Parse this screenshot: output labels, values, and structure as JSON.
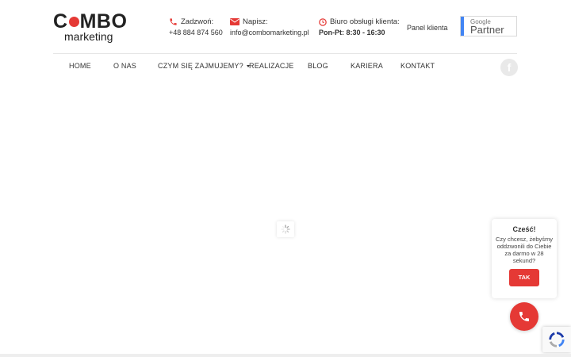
{
  "brand": {
    "logo_top_left": "C",
    "logo_top_right": "MBO",
    "logo_bottom": "marketing",
    "accent_color": "#e53935"
  },
  "contacts": {
    "phone": {
      "label": "Zadzwoń:",
      "value": "+48 884 874 560",
      "icon": "phone-icon"
    },
    "email": {
      "label": "Napisz:",
      "value": "info@combomarketing.pl",
      "icon": "mail-icon"
    },
    "office": {
      "label": "Biuro obsługi klienta:",
      "value": "Pon-Pt: 8:30 - 16:30",
      "icon": "clock-icon"
    }
  },
  "panel_klienta": "Panel klienta",
  "google_partner": {
    "small": "Google",
    "big": "Partner"
  },
  "nav": {
    "items": [
      {
        "label": "HOME"
      },
      {
        "label": "O NAS"
      },
      {
        "label": "CZYM SIĘ ZAJMUJEMY?"
      },
      {
        "label": "REALIZACJE"
      },
      {
        "label": "BLOG"
      },
      {
        "label": "KARIERA"
      },
      {
        "label": "KONTAKT"
      }
    ]
  },
  "social": {
    "facebook_glyph": "f"
  },
  "chat": {
    "title": "Cześć!",
    "text": "Czy chcesz, żebyśmy oddzwonili do Ciebie za darmo w 28 sekund?",
    "button": "TAK"
  }
}
